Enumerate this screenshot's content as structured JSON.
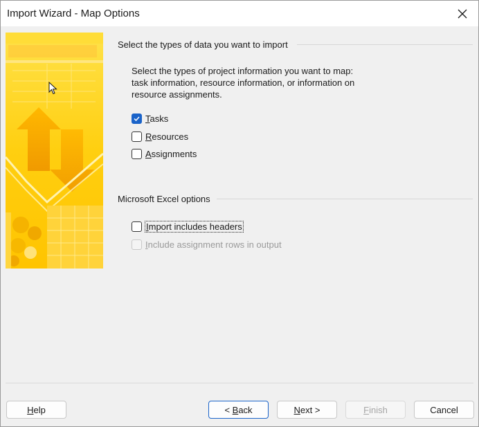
{
  "window": {
    "title": "Import Wizard - Map Options",
    "close_icon": "close-icon"
  },
  "banner": {
    "description_icon": "import-wizard-banner-graphic",
    "colors": {
      "base": "#ffd21a",
      "light": "#ffe45c",
      "dark": "#f2a900",
      "accent": "#ffb300"
    }
  },
  "section_data_types": {
    "header": "Select the types of data you want to import",
    "description_lines": [
      "Select the types of project information you want to map:",
      "task information, resource information, or information on",
      "resource assignments."
    ],
    "options": [
      {
        "mnemonic": "T",
        "rest": "asks",
        "checked": true
      },
      {
        "mnemonic": "R",
        "rest": "esources",
        "checked": false
      },
      {
        "mnemonic": "A",
        "rest": "ssignments",
        "checked": false
      }
    ]
  },
  "section_excel": {
    "header": "Microsoft Excel options",
    "import_headers": {
      "mnemonic": "I",
      "rest": "mport includes headers",
      "checked": false,
      "focused": true
    },
    "include_assignment_rows": {
      "mnemonic": "I",
      "rest": "nclude assignment rows in output",
      "checked": false,
      "enabled": false
    }
  },
  "buttons": {
    "help": {
      "mnemonic": "H",
      "rest": "elp"
    },
    "back": {
      "prefix": "< ",
      "mnemonic": "B",
      "rest": "ack"
    },
    "next": {
      "mnemonic": "N",
      "rest": "ext >"
    },
    "finish": {
      "mnemonic": "F",
      "rest": "inish",
      "enabled": false
    },
    "cancel": {
      "label": "Cancel"
    }
  },
  "accent_color": "#1a63c9"
}
